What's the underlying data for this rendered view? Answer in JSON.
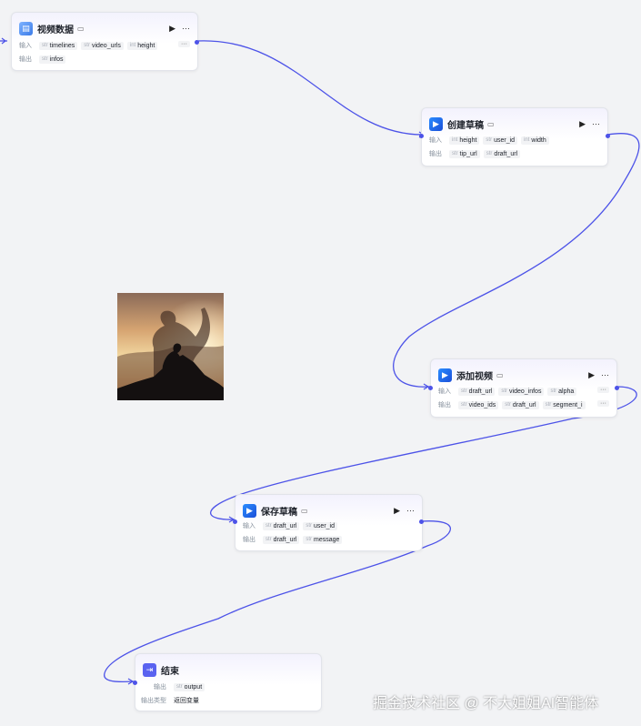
{
  "nodes": {
    "video_data": {
      "title": "视频数据",
      "input_label": "输入",
      "output_label": "输出",
      "inputs": [
        {
          "type": "str",
          "name": "timelines"
        },
        {
          "type": "str",
          "name": "video_urls"
        },
        {
          "type": "int",
          "name": "height"
        }
      ],
      "outputs": [
        {
          "type": "str",
          "name": "infos"
        }
      ]
    },
    "create_draft": {
      "title": "创建草稿",
      "input_label": "输入",
      "output_label": "输出",
      "inputs": [
        {
          "type": "int",
          "name": "height"
        },
        {
          "type": "str",
          "name": "user_id"
        },
        {
          "type": "int",
          "name": "width"
        }
      ],
      "outputs": [
        {
          "type": "str",
          "name": "tip_url"
        },
        {
          "type": "str",
          "name": "draft_url"
        }
      ]
    },
    "add_video": {
      "title": "添加视频",
      "input_label": "输入",
      "output_label": "输出",
      "inputs": [
        {
          "type": "str",
          "name": "draft_url"
        },
        {
          "type": "str",
          "name": "video_infos"
        },
        {
          "type": "str",
          "name": "alpha"
        }
      ],
      "outputs": [
        {
          "type": "str",
          "name": "video_ids"
        },
        {
          "type": "str",
          "name": "draft_url"
        },
        {
          "type": "str",
          "name": "segment_i"
        }
      ]
    },
    "save_draft": {
      "title": "保存草稿",
      "input_label": "输入",
      "output_label": "输出",
      "inputs": [
        {
          "type": "str",
          "name": "draft_url"
        },
        {
          "type": "str",
          "name": "user_id"
        }
      ],
      "outputs": [
        {
          "type": "str",
          "name": "draft_url"
        },
        {
          "type": "str",
          "name": "message"
        }
      ]
    },
    "end": {
      "title": "结束",
      "output_label": "输出",
      "output_var": {
        "type": "str",
        "name": "output"
      },
      "output_kind_label": "输出类型",
      "output_kind_value": "返回变量"
    }
  },
  "icons": {
    "run": "play-icon",
    "more": "ellipsis-icon",
    "doc": "doc-icon"
  },
  "colors": {
    "edge": "#4d53e8",
    "accent": "#4d53e8"
  },
  "watermark": "掘金技术社区 @ 不大姐姐AI智能体"
}
